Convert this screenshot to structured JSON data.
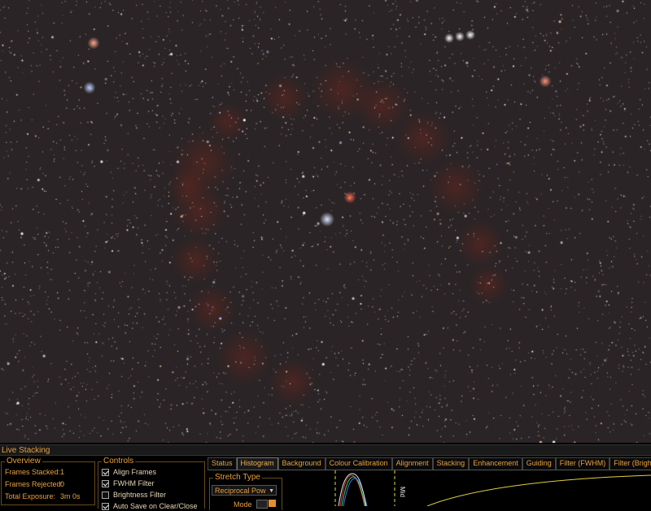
{
  "live_stacking": {
    "title": "Live Stacking",
    "overview": {
      "title": "Overview",
      "frames_stacked_label": "Frames Stacked:",
      "frames_stacked_value": "1",
      "frames_rejected_label": "Frames Rejected:",
      "frames_rejected_value": "0",
      "total_exposure_label": "Total Exposure:",
      "total_exposure_value": "3m 0s"
    },
    "controls": {
      "title": "Controls",
      "items": [
        {
          "label": "Align Frames",
          "checked": true
        },
        {
          "label": "FWHM Filter",
          "checked": true
        },
        {
          "label": "Brightness Filter",
          "checked": false
        },
        {
          "label": "Auto Save on Clear/Close",
          "checked": true
        }
      ]
    },
    "tabs": [
      "Status",
      "Histogram",
      "Background",
      "Colour Calibration",
      "Alignment",
      "Stacking",
      "Enhancement",
      "Guiding",
      "Filter (FWHM)",
      "Filter (Brightness)"
    ],
    "active_tab": "Histogram",
    "histogram": {
      "stretch_type_title": "Stretch Type",
      "stretch_type_value": "Reciprocal Pow",
      "mode_label": "Mode",
      "marker_label": "Mid"
    }
  },
  "colors": {
    "accent": "#e8a040",
    "nebula": "#8a2a1a",
    "sky": "#2a2426"
  }
}
